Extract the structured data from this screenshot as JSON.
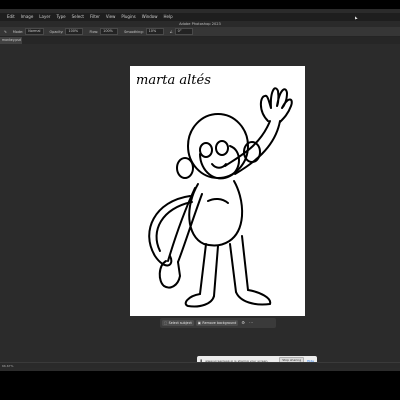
{
  "menubar": {
    "items": [
      "Edit",
      "Image",
      "Layer",
      "Type",
      "Select",
      "Filter",
      "View",
      "Plugins",
      "Window",
      "Help"
    ]
  },
  "titlebar": {
    "title": "Adobe Photoshop 2023"
  },
  "optionsbar": {
    "mode_label": "Mode:",
    "mode_value": "Normal",
    "opacity_label": "Opacity:",
    "opacity_value": "100%",
    "flow_label": "Flow:",
    "flow_value": "100%",
    "smoothing_label": "Smoothing:",
    "smoothing_value": "10%",
    "angle_value": "0°"
  },
  "document": {
    "tab_label": "monkey.psd @ 66.7% (Layer 1, RGB/8)"
  },
  "artwork": {
    "signature": "marta altés"
  },
  "taskbar": {
    "select_subject_label": "Select subject",
    "remove_background_label": "Remove background"
  },
  "screen_share": {
    "message": "www.screenleap.io is sharing your screen.",
    "stop_label": "Stop sharing",
    "hide_label": "Hide"
  },
  "statusbar": {
    "zoom": "66.67%"
  },
  "colors": {
    "app_bg": "#2b2b2b",
    "canvas": "#ffffff",
    "link": "#1a73e8"
  }
}
